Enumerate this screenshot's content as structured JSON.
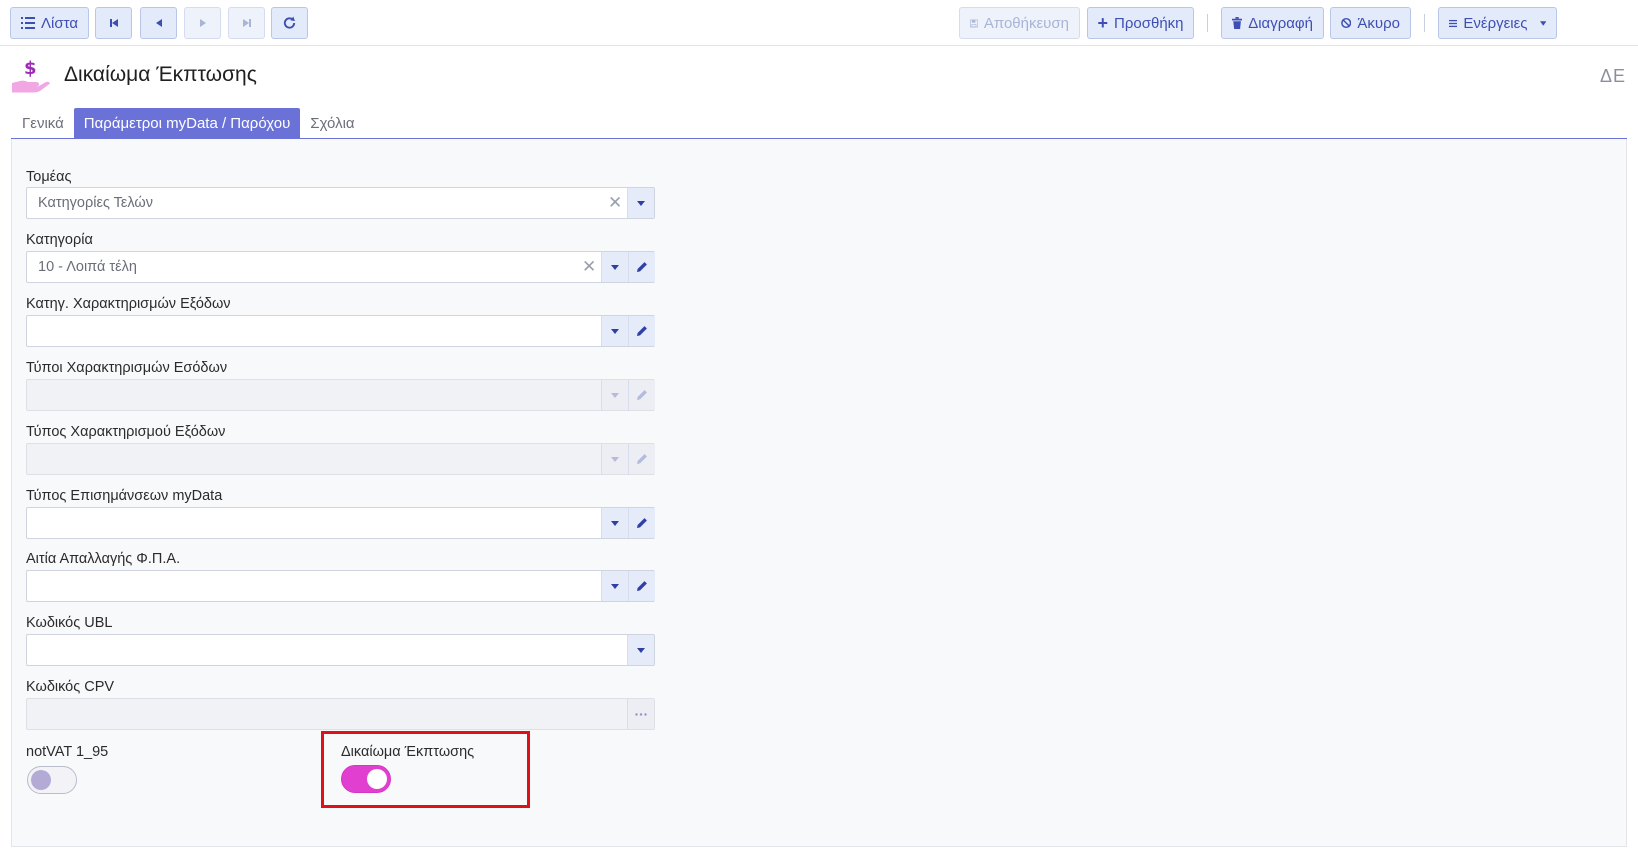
{
  "toolbar": {
    "list_label": "Λίστα",
    "save_label": "Αποθήκευση",
    "add_label": "Προσθήκη",
    "delete_label": "Διαγραφή",
    "cancel_label": "Άκυρο",
    "actions_label": "Ενέργειες"
  },
  "header": {
    "title": "Δικαίωμα Έκπτωσης",
    "lang": "ΔΕ",
    "icon": "hand-dollar-icon"
  },
  "tabs": [
    {
      "label": "Γενικά",
      "active": false
    },
    {
      "label": "Παράμετροι myData / Παρόχου",
      "active": true
    },
    {
      "label": "Σχόλια",
      "active": false
    }
  ],
  "form": {
    "sector": {
      "label": "Τομέας",
      "value": "Κατηγορίες Τελών"
    },
    "category": {
      "label": "Κατηγορία",
      "value": "10 - Λοιπά τέλη"
    },
    "expense_char_category": {
      "label": "Κατηγ. Χαρακτηρισμών Εξόδων",
      "value": ""
    },
    "income_char_types": {
      "label": "Τύποι Χαρακτηρισμών Εσόδων",
      "value": ""
    },
    "expense_char_type": {
      "label": "Τύπος Χαρακτηρισμού Εξόδων",
      "value": ""
    },
    "mydata_remarks_type": {
      "label": "Τύπος Επισημάνσεων myData",
      "value": ""
    },
    "vat_exemption_reason": {
      "label": "Αιτία Απαλλαγής Φ.Π.Α.",
      "value": ""
    },
    "ubl_code": {
      "label": "Κωδικός UBL",
      "value": ""
    },
    "cpv_code": {
      "label": "Κωδικός CPV",
      "value": ""
    },
    "not_vat": {
      "label": "notVAT 1_95",
      "on": false
    },
    "discount_right": {
      "label": "Δικαίωμα Έκπτωσης",
      "on": true
    }
  },
  "colors": {
    "accent": "#6a72d8",
    "button_bg": "#e3ebfb",
    "button_text": "#3e4fb3",
    "toggle_on": "#e03fcf",
    "highlight": "#e0101a"
  }
}
